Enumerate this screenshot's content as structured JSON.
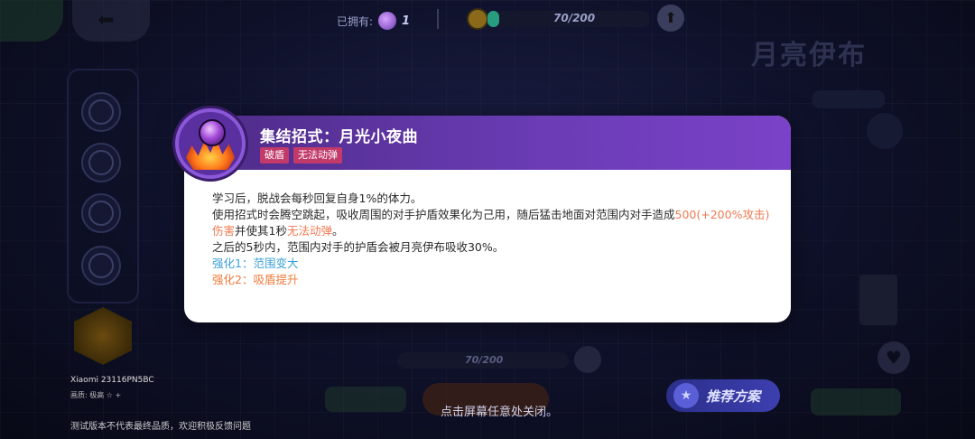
{
  "topbar": {
    "owned_label": "已拥有:",
    "owned_count": "1",
    "progress_text": "70/200",
    "progress_fraction": 0.07
  },
  "hero": {
    "name": "月亮伊布"
  },
  "left": {
    "device": "Xiaomi 23116PN5BC",
    "quality": "画质: 极高 ☆ +",
    "test_note": "测试版本不代表最终品质，欢迎积极反馈问题"
  },
  "bottom": {
    "progress_text": "70/200",
    "close_hint": "点击屏幕任意处关闭。",
    "recommend_label": "推荐方案"
  },
  "modal": {
    "title": "集结招式：月光小夜曲",
    "tags": [
      "破盾",
      "无法动弹"
    ],
    "line1": "学习后，脱战会每秒回复自身1%的体力。",
    "line2_a": "使用招式时会腾空跳起，吸收周围的对手护盾效果化为己用，随后猛击地面对范围内对手造成",
    "line2_dmg": "500(+200%攻击)伤害",
    "line2_b": "并使其1秒",
    "line2_status": "无法动弹",
    "line2_c": "。",
    "line3": "之后的5秒内，范围内对手的护盾会被月亮伊布吸收30%。",
    "enhance1": "强化1：范围变大",
    "enhance2": "强化2：吸盾提升"
  },
  "colors": {
    "header_purple": "#6b3cb6",
    "tag_pink": "#c23a6a",
    "damage_orange": "#ef7a52",
    "status_pink": "#e25a8a",
    "enhance1_blue": "#3aa0d8",
    "enhance2_orange": "#ef7a3a"
  }
}
